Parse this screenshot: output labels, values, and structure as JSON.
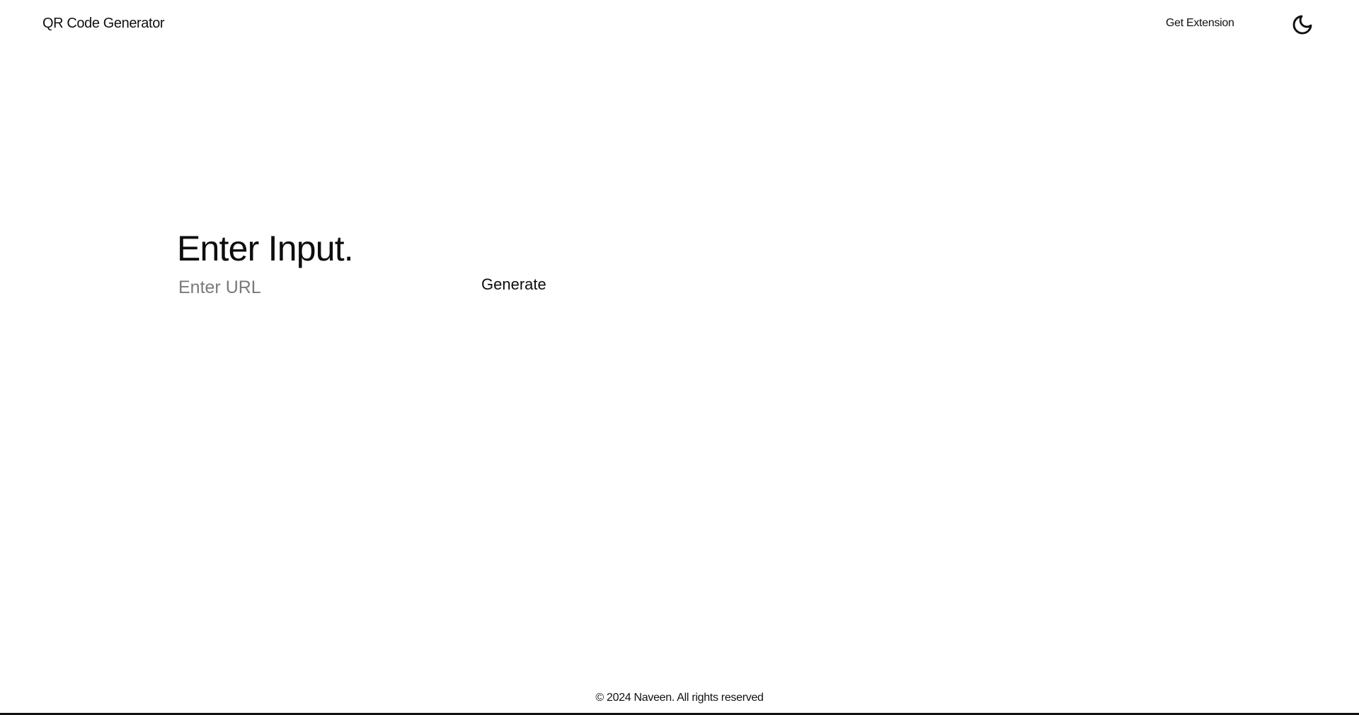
{
  "header": {
    "brand": "QR Code Generator",
    "extension_link": "Get Extension",
    "theme_icon": "moon-icon"
  },
  "main": {
    "title": "Enter Input.",
    "input": {
      "placeholder": "Enter URL",
      "value": ""
    },
    "generate_label": "Generate"
  },
  "footer": {
    "copyright": "© 2024 Naveen. All rights reserved"
  },
  "colors": {
    "background": "#ffffff",
    "text": "#111111",
    "placeholder": "#7a7a7a"
  }
}
